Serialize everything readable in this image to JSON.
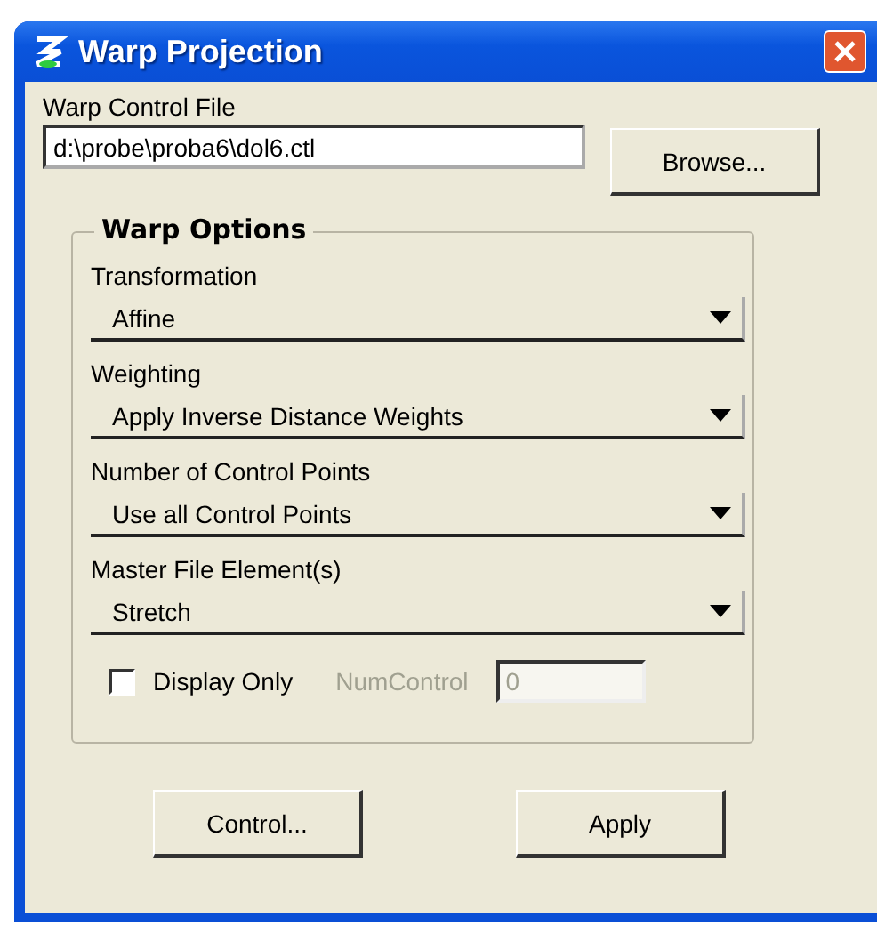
{
  "window": {
    "title": "Warp Projection"
  },
  "control_file": {
    "label": "Warp Control File",
    "value": "d:\\probe\\proba6\\dol6.ctl",
    "browse_button": "Browse..."
  },
  "warp_options": {
    "title": "Warp Options",
    "dropdowns": [
      {
        "label": "Transformation",
        "value": "Affine"
      },
      {
        "label": "Weighting",
        "value": "Apply Inverse Distance Weights"
      },
      {
        "label": "Number of Control Points",
        "value": "Use all Control Points"
      },
      {
        "label": "Master File Element(s)",
        "value": "Stretch"
      }
    ],
    "display_only": {
      "label": "Display Only",
      "checked": false
    },
    "num_control": {
      "label": "NumControl",
      "value": "0",
      "disabled": true
    }
  },
  "buttons": [
    "Control...",
    "Apply"
  ]
}
